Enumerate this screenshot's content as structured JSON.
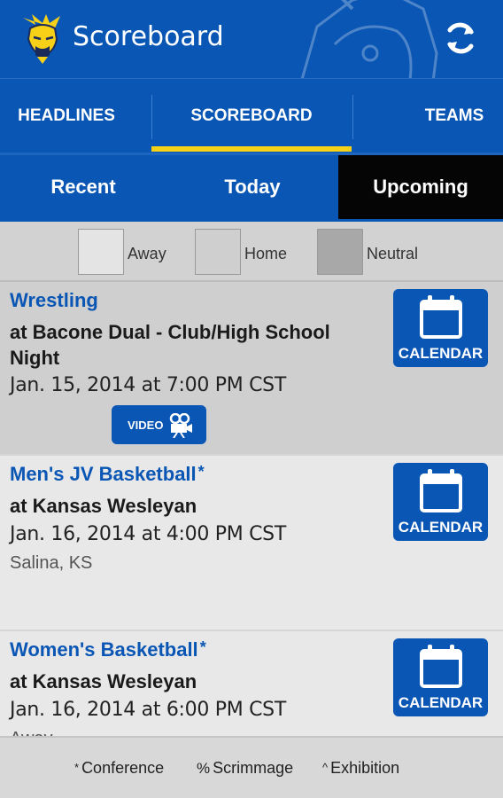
{
  "app": {
    "title": "Scoreboard"
  },
  "main_tabs": [
    {
      "label": "HEADLINES"
    },
    {
      "label": "SCOREBOARD",
      "selected": true
    },
    {
      "label": "TEAMS"
    }
  ],
  "sub_tabs": [
    {
      "label": "Recent"
    },
    {
      "label": "Today"
    },
    {
      "label": "Upcoming",
      "selected": true
    }
  ],
  "legend": [
    {
      "label": "Away",
      "color": "#e4e4e4"
    },
    {
      "label": "Home",
      "color": "#cfcfcf"
    },
    {
      "label": "Neutral",
      "color": "#a8a8a8"
    }
  ],
  "events": [
    {
      "sport": "Wrestling",
      "conference_mark": "",
      "opponent": "at Bacone Dual - Club/High School Night",
      "datetime": "Jan. 15, 2014 at 7:00 PM CST",
      "location": "",
      "calendar_label": "CALENDAR",
      "video_label": "VIDEO"
    },
    {
      "sport": "Men's JV Basketball",
      "conference_mark": "*",
      "opponent": "at Kansas Wesleyan",
      "datetime": "Jan. 16, 2014 at 4:00 PM CST",
      "location": "Salina, KS",
      "calendar_label": "CALENDAR"
    },
    {
      "sport": "Women's Basketball",
      "conference_mark": "*",
      "opponent": "at Kansas Wesleyan",
      "datetime": "Jan. 16, 2014 at 6:00 PM CST",
      "location": "Away",
      "calendar_label": "CALENDAR"
    }
  ],
  "footer": [
    {
      "symbol": "*",
      "label": "Conference"
    },
    {
      "symbol": "%",
      "label": "Scrimmage"
    },
    {
      "symbol": "^",
      "label": "Exhibition"
    }
  ],
  "colors": {
    "brand_blue": "#0a56b4",
    "accent_yellow": "#f7d117",
    "selected_subtab": "#050505"
  },
  "icons": {
    "logo": "viking-logo-icon",
    "refresh": "refresh-icon",
    "calendar": "calendar-icon",
    "video": "video-camera-icon"
  }
}
